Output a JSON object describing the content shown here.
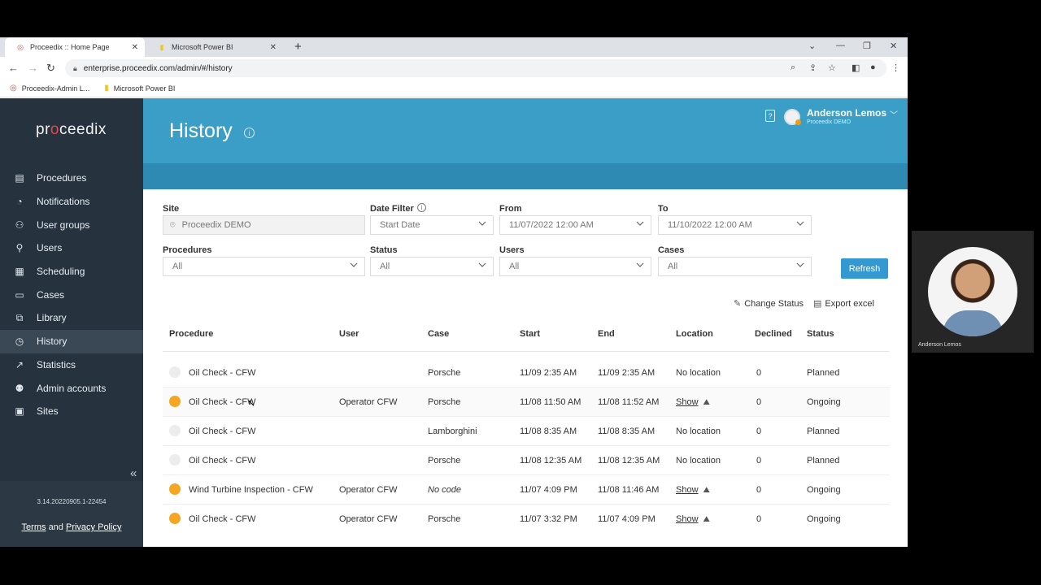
{
  "browser": {
    "tabs": [
      {
        "title": "Proceedix :: Home Page",
        "icon": "proceedix-favicon"
      },
      {
        "title": "Microsoft Power BI",
        "icon": "powerbi-favicon"
      }
    ],
    "url": "enterprise.proceedix.com/admin/#/history",
    "bookmarks": [
      {
        "label": "Proceedix-Admin L...",
        "icon": "proceedix-favicon"
      },
      {
        "label": "Microsoft Power BI",
        "icon": "powerbi-favicon"
      }
    ]
  },
  "sidebar": {
    "logo": "proceedix",
    "items": [
      {
        "label": "Procedures",
        "icon": "procedures-icon",
        "active": false
      },
      {
        "label": "Notifications",
        "icon": "bell-icon",
        "active": false
      },
      {
        "label": "User groups",
        "icon": "user-groups-icon",
        "active": false
      },
      {
        "label": "Users",
        "icon": "user-icon",
        "active": false
      },
      {
        "label": "Scheduling",
        "icon": "calendar-icon",
        "active": false
      },
      {
        "label": "Cases",
        "icon": "cases-icon",
        "active": false
      },
      {
        "label": "Library",
        "icon": "library-icon",
        "active": false
      },
      {
        "label": "History",
        "icon": "history-icon",
        "active": true
      },
      {
        "label": "Statistics",
        "icon": "statistics-icon",
        "active": false
      },
      {
        "label": "Admin accounts",
        "icon": "admin-accounts-icon",
        "active": false
      },
      {
        "label": "Sites",
        "icon": "sites-icon",
        "active": false
      }
    ],
    "version": "3.14.20220905.1-22454",
    "terms_label": "Terms",
    "and_label": "and",
    "privacy_label": "Privacy Policy"
  },
  "header": {
    "title": "History",
    "user_name": "Anderson Lemos",
    "user_org": "Proceedix DEMO"
  },
  "filters": {
    "site": {
      "label": "Site",
      "value": "Proceedix DEMO"
    },
    "date_filter": {
      "label": "Date Filter",
      "value": "Start Date"
    },
    "from": {
      "label": "From",
      "value": "11/07/2022 12:00 AM"
    },
    "to": {
      "label": "To",
      "value": "11/10/2022 12:00 AM"
    },
    "procedures": {
      "label": "Procedures",
      "value": "All"
    },
    "status": {
      "label": "Status",
      "value": "All"
    },
    "users": {
      "label": "Users",
      "value": "All"
    },
    "cases": {
      "label": "Cases",
      "value": "All"
    },
    "refresh_label": "Refresh"
  },
  "actions": {
    "change_status": "Change Status",
    "export_excel": "Export excel"
  },
  "table": {
    "columns": [
      "Procedure",
      "User",
      "Case",
      "Start",
      "End",
      "Location",
      "Declined",
      "Status"
    ],
    "rows": [
      {
        "state": "planned",
        "procedure": "Oil Check - CFW",
        "user": "",
        "case": "Porsche",
        "case_italic": false,
        "start": "11/09 2:35 AM",
        "end": "11/09 2:35 AM",
        "location": "No location",
        "has_map": false,
        "declined": "0",
        "status": "Planned"
      },
      {
        "state": "ongoing",
        "procedure": "Oil Check - CFW",
        "user": "Operator CFW",
        "case": "Porsche",
        "case_italic": false,
        "start": "11/08 11:50 AM",
        "end": "11/08 11:52 AM",
        "location": "Show",
        "has_map": true,
        "declined": "0",
        "status": "Ongoing"
      },
      {
        "state": "planned",
        "procedure": "Oil Check - CFW",
        "user": "",
        "case": "Lamborghini",
        "case_italic": false,
        "start": "11/08 8:35 AM",
        "end": "11/08 8:35 AM",
        "location": "No location",
        "has_map": false,
        "declined": "0",
        "status": "Planned"
      },
      {
        "state": "planned",
        "procedure": "Oil Check - CFW",
        "user": "",
        "case": "Porsche",
        "case_italic": false,
        "start": "11/08 12:35 AM",
        "end": "11/08 12:35 AM",
        "location": "No location",
        "has_map": false,
        "declined": "0",
        "status": "Planned"
      },
      {
        "state": "ongoing",
        "procedure": "Wind Turbine Inspection - CFW",
        "user": "Operator CFW",
        "case": "No code",
        "case_italic": true,
        "start": "11/07 4:09 PM",
        "end": "11/08 11:46 AM",
        "location": "Show",
        "has_map": true,
        "declined": "0",
        "status": "Ongoing"
      },
      {
        "state": "ongoing",
        "procedure": "Oil Check - CFW",
        "user": "Operator CFW",
        "case": "Porsche",
        "case_italic": false,
        "start": "11/07 3:32 PM",
        "end": "11/07 4:09 PM",
        "location": "Show",
        "has_map": true,
        "declined": "0",
        "status": "Ongoing"
      }
    ]
  },
  "webcam": {
    "name": "Anderson Lemos"
  },
  "colors": {
    "sidebar": "#26323d",
    "header": "#3b9ec6",
    "accent": "#3498d1",
    "ongoing": "#f5a623",
    "planned": "#ececec"
  }
}
